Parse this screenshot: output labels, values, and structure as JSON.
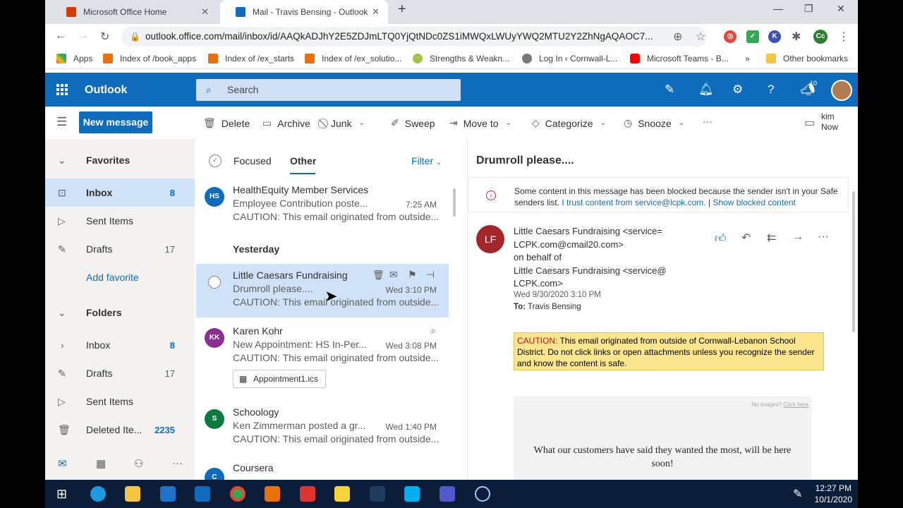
{
  "browser": {
    "tabs": [
      {
        "title": "Microsoft Office Home"
      },
      {
        "title": "Mail - Travis Bensing - Outlook"
      }
    ],
    "new_tab_icon": "plus-icon",
    "url": "outlook.office.com/mail/inbox/id/AAQkADJhY2E5ZDJmLTQ0YjQtNDc0ZS1iMWQxLWUyYWQ2MTU2Y2ZhNgAQAOC7...",
    "bookmarks": [
      {
        "label": "Apps"
      },
      {
        "label": "Index of /book_apps"
      },
      {
        "label": "Index of /ex_starts"
      },
      {
        "label": "Index of /ex_solutio..."
      },
      {
        "label": "Strengths & Weakn..."
      },
      {
        "label": "Log In ‹ Cornwall-L..."
      },
      {
        "label": "Microsoft Teams - B..."
      },
      {
        "label": "Other bookmarks"
      }
    ],
    "more_bookmarks": "»"
  },
  "outlook": {
    "brand": "Outlook",
    "search_placeholder": "Search",
    "notification_badge": "10",
    "new_message": "New message",
    "commands": [
      "Delete",
      "Archive",
      "Junk",
      "Sweep",
      "Move to",
      "Categorize",
      "Snooze"
    ],
    "more": "···",
    "reminder": {
      "name": "kim",
      "time": "Now"
    }
  },
  "sidebar": {
    "favorites_header": "Favorites",
    "favorites": [
      {
        "label": "Inbox",
        "count": "8"
      },
      {
        "label": "Sent Items",
        "count": ""
      },
      {
        "label": "Drafts",
        "count": "17"
      }
    ],
    "add_favorite": "Add favorite",
    "folders_header": "Folders",
    "folders": [
      {
        "label": "Inbox",
        "count": "8"
      },
      {
        "label": "Drafts",
        "count": "17"
      },
      {
        "label": "Sent Items",
        "count": ""
      },
      {
        "label": "Deleted Ite...",
        "count": "2235"
      }
    ]
  },
  "message_list": {
    "tabs": [
      "Focused",
      "Other"
    ],
    "filter": "Filter",
    "group_yesterday": "Yesterday",
    "messages": [
      {
        "initials": "HS",
        "from": "HealthEquity Member Services",
        "subject": "Employee Contribution poste...",
        "time": "7:25 AM",
        "preview": "CAUTION: This email originated from outside...",
        "color": "#0f6cbd"
      },
      {
        "initials": "",
        "from": "Little Caesars Fundraising",
        "subject": "Drumroll please....",
        "time": "Wed 3:10 PM",
        "preview": "CAUTION: This email originated from outside...",
        "color": ""
      },
      {
        "initials": "KK",
        "from": "Karen Kohr",
        "subject": "New Appointment: HS In-Per...",
        "time": "Wed 3:08 PM",
        "preview": "CAUTION: This email originated from outside...",
        "color": "#8a2e8f",
        "attachment": "Appointment1.ics"
      },
      {
        "initials": "S",
        "from": "Schoology",
        "subject": "Ken Zimmerman posted a gr...",
        "time": "Wed 1:40 PM",
        "preview": "CAUTION: This email originated from outside...",
        "color": "#0b7a3e"
      },
      {
        "initials": "C",
        "from": "Coursera",
        "subject": "",
        "time": "",
        "preview": "",
        "color": "#0f6cbd"
      }
    ]
  },
  "reading_pane": {
    "subject": "Drumroll please....",
    "blocked_notice": "Some content in this message has been blocked because the sender isn't in your Safe senders list.",
    "trust_link": "I trust content from service@lcpk.com.",
    "separator": "|",
    "show_blocked_link": "Show blocked content",
    "sender_initials": "LF",
    "sender_line1": "Little Caesars Fundraising <service=",
    "sender_line2": "LCPK.com@cmail20.com>",
    "on_behalf": "on behalf of",
    "sender_line3": "Little Caesars Fundraising <service@",
    "sender_line4": "LCPK.com>",
    "date": "Wed 9/30/2020 3:10 PM",
    "to_label": "To:",
    "to": "Travis Bensing",
    "caution_label": "CAUTION:",
    "caution_text": " This email originated from outside of Cornwall-Lebanon School District. Do not click links or open attachments unless you recognize the sender and know the content is safe.",
    "no_images": "No images?",
    "click_here": "Click here",
    "body_text": "What our customers have said they wanted the most, will be here soon!"
  },
  "taskbar": {
    "time": "12:27 PM",
    "date": "10/1/2020"
  }
}
